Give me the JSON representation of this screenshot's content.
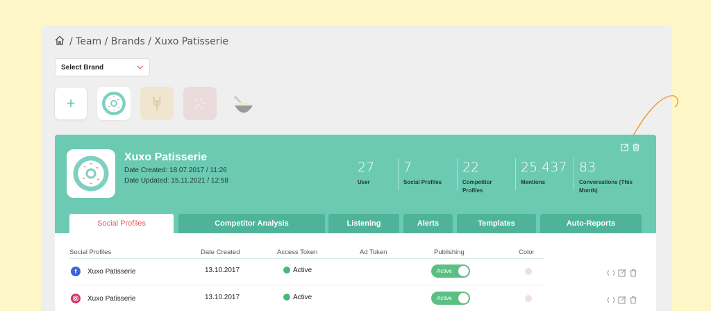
{
  "breadcrumb": {
    "path": "/ Team / Brands / Xuxo Patisserie"
  },
  "brand_select": {
    "label": "Select Brand"
  },
  "brand": {
    "name": "Xuxo Patisserie",
    "date_created": "Date Created: 18.07.2017 / 11:26",
    "date_updated": "Date Updated: 15.11.2021 / 12:58"
  },
  "stats": [
    {
      "value": "27",
      "label": "User"
    },
    {
      "value": "7",
      "label": "Social Profiles"
    },
    {
      "value": "22",
      "label": "Competitor Profiles"
    },
    {
      "value": "25.437",
      "label": "Mentions"
    },
    {
      "value": "83",
      "label": "Conversations (This Month)"
    }
  ],
  "tabs": [
    {
      "label": "Social Profiles",
      "active": true
    },
    {
      "label": "Competitor Analysis"
    },
    {
      "label": "Listening"
    },
    {
      "label": "Alerts"
    },
    {
      "label": "Templates"
    },
    {
      "label": "Auto-Reports"
    }
  ],
  "table": {
    "headers": [
      "Social Profiles",
      "Date Created",
      "Access Token",
      "Ad Token",
      "Publishing",
      "Color"
    ],
    "rows": [
      {
        "network": "facebook",
        "name": "Xuxo Patisserie",
        "date": "13.10.2017",
        "access": "Active",
        "publishing": "Active"
      },
      {
        "network": "instagram",
        "name": "Xuxo Patisserie",
        "date": "13.10.2017",
        "access": "Active",
        "publishing": "Active"
      }
    ]
  },
  "colors": {
    "background": "#fdf7c7",
    "card": "#6ccab3",
    "tab": "#4fb39a",
    "active_tab_text": "#e05a5a",
    "status_green": "#49b87a",
    "arrow": "#f0962c"
  },
  "icons": [
    "home-icon",
    "chevron-down-icon",
    "plus-icon",
    "edit-icon",
    "trash-icon",
    "refresh-icon",
    "facebook-icon",
    "instagram-icon"
  ]
}
